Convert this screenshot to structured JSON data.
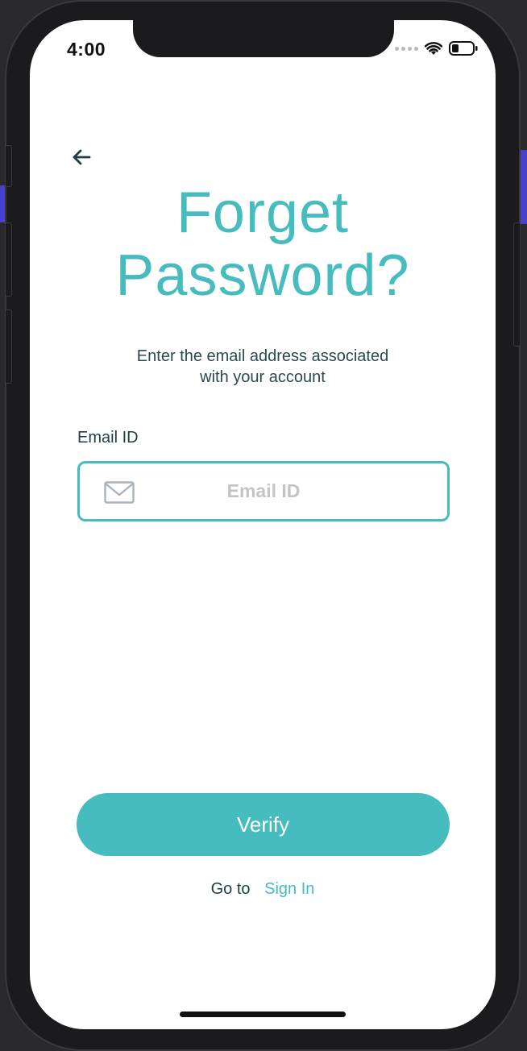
{
  "status_bar": {
    "time": "4:00"
  },
  "page": {
    "title_line1": "Forget",
    "title_line2": "Password?",
    "subtitle_line1": "Enter the email address associated",
    "subtitle_line2": "with your account"
  },
  "form": {
    "email_label": "Email ID",
    "email_value": "",
    "email_placeholder": "Email ID"
  },
  "actions": {
    "verify_label": "Verify",
    "goto_text": "Go to",
    "signin_link": "Sign In"
  },
  "colors": {
    "accent": "#46bcbf",
    "text_dark": "#1f3e40",
    "placeholder": "#c4c4c4"
  },
  "icons": {
    "back": "arrow-left-icon",
    "mail": "envelope-icon",
    "wifi": "wifi-icon",
    "battery": "battery-icon"
  }
}
